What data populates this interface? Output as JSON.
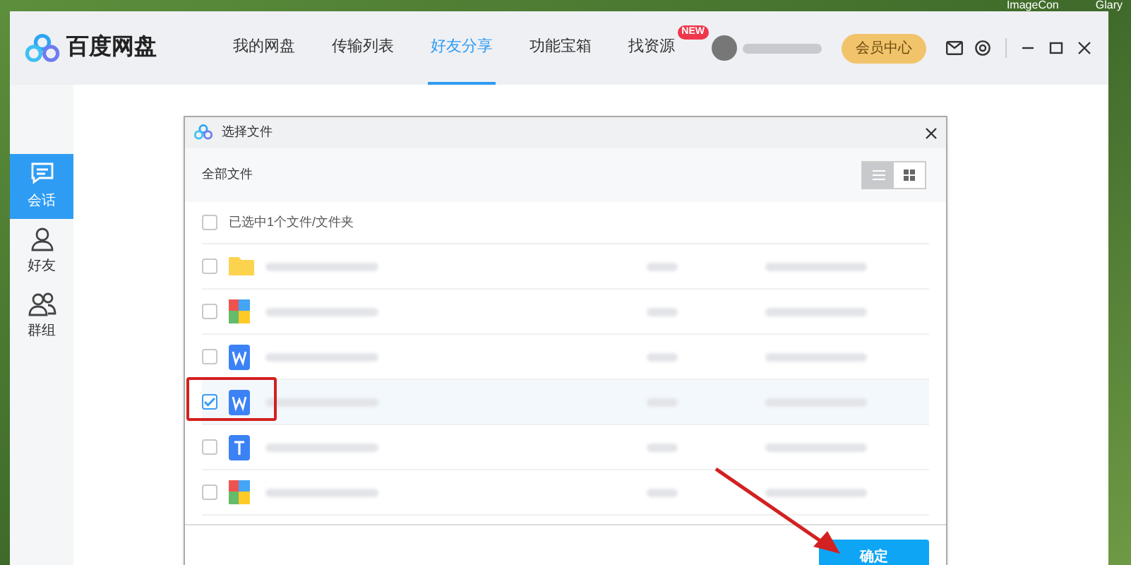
{
  "desktop": {
    "icon_labels": [
      "ImageCon",
      "Glary"
    ]
  },
  "app": {
    "logo": "百度网盘",
    "tabs": [
      {
        "label": "我的网盘",
        "selected": false
      },
      {
        "label": "传输列表",
        "selected": false
      },
      {
        "label": "好友分享",
        "selected": true
      },
      {
        "label": "功能宝箱",
        "selected": false
      },
      {
        "label": "找资源",
        "selected": false,
        "badge": "NEW"
      }
    ],
    "vip_button": "会员中心"
  },
  "sidebar": {
    "items": [
      {
        "label": "会话",
        "kind": "chat",
        "selected": true
      },
      {
        "label": "好友",
        "kind": "person",
        "selected": false
      },
      {
        "label": "群组",
        "kind": "group",
        "selected": false
      }
    ]
  },
  "dialog": {
    "title": "选择文件",
    "breadcrumb": "全部文件",
    "view_toggle": [
      {
        "kind": "list",
        "selected": true
      },
      {
        "kind": "grid",
        "selected": false
      }
    ],
    "select_all": {
      "label": "已选中1个文件/文件夹",
      "checked": false
    },
    "files": [
      {
        "kind": "folder",
        "checked": false
      },
      {
        "kind": "archive",
        "checked": false
      },
      {
        "kind": "word",
        "checked": false
      },
      {
        "kind": "word",
        "checked": true
      },
      {
        "kind": "text",
        "checked": false
      },
      {
        "kind": "archive",
        "checked": false
      }
    ],
    "confirm_button": "确定"
  }
}
